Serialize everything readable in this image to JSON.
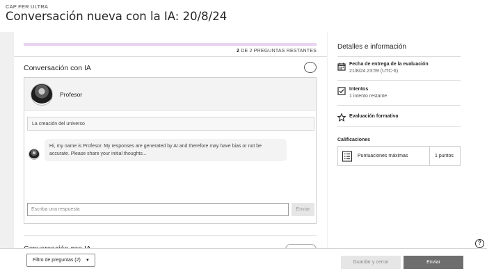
{
  "header": {
    "course": "CAP FER ULTRA",
    "title": "Conversación nueva con la IA: 20/8/24"
  },
  "progress": {
    "fill_fraction": 1.0,
    "current": "2",
    "text": "DE 2 PREGUNTAS RESTANTES"
  },
  "conversation": {
    "section_title": "Conversación con IA",
    "persona_name": "Profesor",
    "topic": "La creación del universo",
    "ai_message": "Hi, my name is Profesor. My responses are generated by AI and therefore may have bias or not be accurate. Please share your initial thoughts...",
    "reply_placeholder": "Escriba una respuesta",
    "send_label": "Enviar"
  },
  "sidebar": {
    "title": "Detalles e información",
    "due_label": "Fecha de entrega de la evaluación",
    "due_value": "21/8/24 23:59 (UTC-6)",
    "attempts_label": "Intentos",
    "attempts_value": "1 intento restante",
    "formative_label": "Evaluación formativa",
    "grades_title": "Calificaciones",
    "score_label": "Puntuaciones máximas",
    "score_value": "1 puntos"
  },
  "footer": {
    "filter_label": "Filtro de preguntas (2)",
    "save_label": "Guardar y cerrar",
    "submit_label": "Enviar"
  }
}
